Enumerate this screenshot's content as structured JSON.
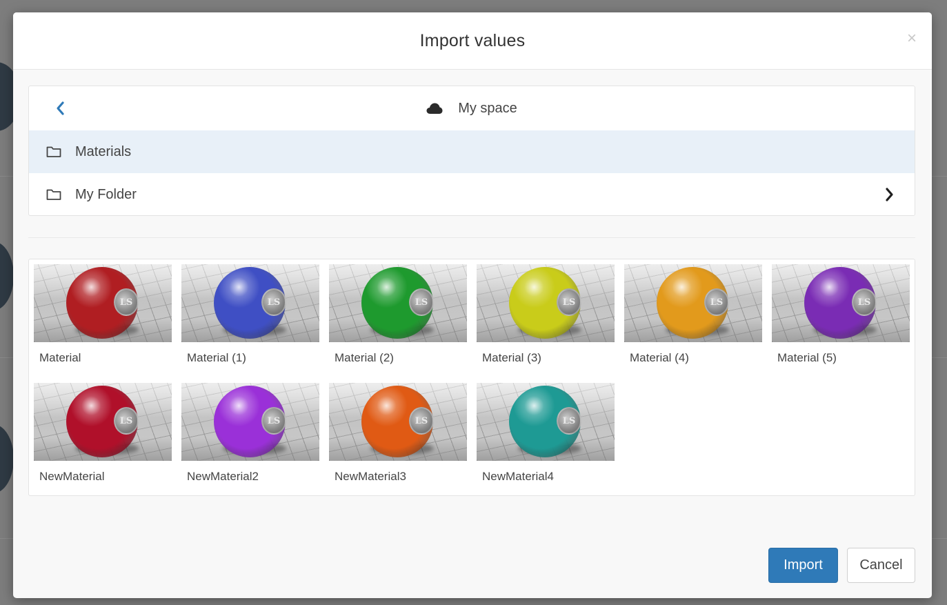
{
  "dialog": {
    "title": "Import values",
    "close_symbol": "×"
  },
  "browser": {
    "location_label": "My space",
    "location_icon": "cloud-icon",
    "folders": [
      {
        "name": "Materials",
        "selected": true
      },
      {
        "name": "My Folder",
        "selected": false,
        "has_children": true
      }
    ]
  },
  "materials": [
    {
      "name": "Material",
      "color": "#b01e22"
    },
    {
      "name": "Material (1)",
      "color": "#3f4fc4"
    },
    {
      "name": "Material (2)",
      "color": "#1e9a2e"
    },
    {
      "name": "Material (3)",
      "color": "#c9cc1a"
    },
    {
      "name": "Material (4)",
      "color": "#e29a1c"
    },
    {
      "name": "Material (5)",
      "color": "#7a2cb4"
    },
    {
      "name": "NewMaterial",
      "color": "#b0102a"
    },
    {
      "name": "NewMaterial2",
      "color": "#9a30d8"
    },
    {
      "name": "NewMaterial3",
      "color": "#e05a14"
    },
    {
      "name": "NewMaterial4",
      "color": "#1e9a94"
    }
  ],
  "thumbnail_badge": "LS",
  "actions": {
    "import_label": "Import",
    "cancel_label": "Cancel",
    "import_color": "#2f7ab8"
  }
}
